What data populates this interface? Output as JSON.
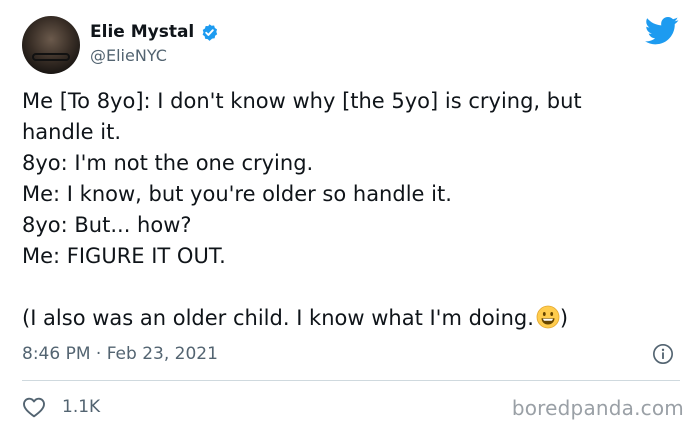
{
  "author": {
    "name": "Elie Mystal",
    "handle": "@ElieNYC",
    "verified": true
  },
  "tweet": {
    "lines": [
      "Me [To 8yo]: I don't know why [the 5yo] is crying, but",
      "handle it.",
      "8yo: I'm not the one crying.",
      "Me: I know, but you're older so handle it.",
      "8yo: But... how?",
      "Me: FIGURE IT OUT.",
      "",
      "(I also was an older child. I know what I'm doing."
    ],
    "closing": ")",
    "emoji": "grinning-face"
  },
  "meta": {
    "timestamp": "8:46 PM · Feb 23, 2021"
  },
  "engagement": {
    "likes": "1.1K"
  },
  "watermark": "boredpanda.com",
  "colors": {
    "text": "#0f1419",
    "secondary": "#536471",
    "brand": "#1d9bf0",
    "divider": "#cfd9de"
  }
}
